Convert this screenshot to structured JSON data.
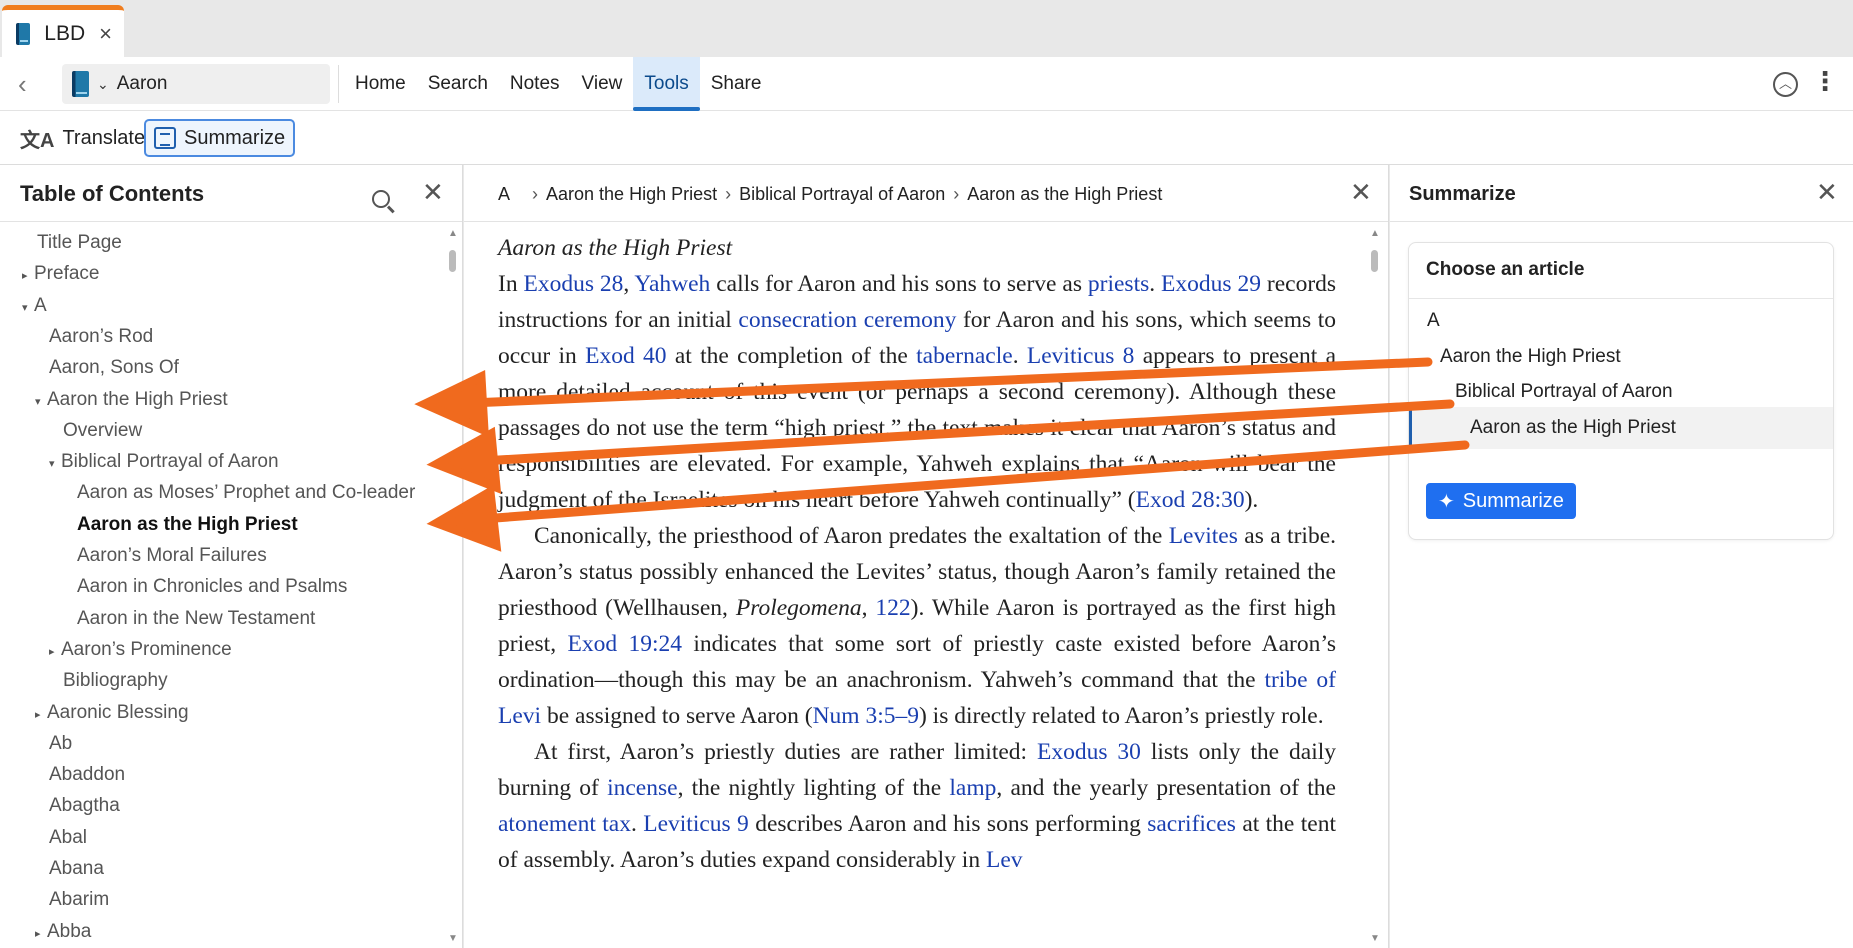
{
  "tab": {
    "title": "LBD",
    "close": "×"
  },
  "nav": {
    "back": "‹",
    "resource": "Aaron",
    "menu": [
      "Home",
      "Search",
      "Notes",
      "View",
      "Tools",
      "Share"
    ],
    "active_menu": "Tools"
  },
  "tools": {
    "translate": "Translate",
    "summarize": "Summarize"
  },
  "toc": {
    "title": "Table of Contents",
    "items": [
      {
        "label": "Title Page",
        "indent": 0,
        "toggle": ""
      },
      {
        "label": "Preface",
        "indent": 0,
        "toggle": "▸"
      },
      {
        "label": "A",
        "indent": 0,
        "toggle": "▾"
      },
      {
        "label": "Aaron’s Rod",
        "indent": 1,
        "toggle": ""
      },
      {
        "label": "Aaron, Sons Of",
        "indent": 1,
        "toggle": ""
      },
      {
        "label": "Aaron the High Priest",
        "indent": 1,
        "toggle": "▾"
      },
      {
        "label": "Overview",
        "indent": 2,
        "toggle": ""
      },
      {
        "label": "Biblical Portrayal of Aaron",
        "indent": 2,
        "toggle": "▾"
      },
      {
        "label": "Aaron as Moses’ Prophet and Co-leader",
        "indent": 3,
        "toggle": ""
      },
      {
        "label": "Aaron as the High Priest",
        "indent": 3,
        "toggle": "",
        "bold": true
      },
      {
        "label": "Aaron’s Moral Failures",
        "indent": 3,
        "toggle": ""
      },
      {
        "label": "Aaron in Chronicles and Psalms",
        "indent": 3,
        "toggle": ""
      },
      {
        "label": "Aaron in the New Testament",
        "indent": 3,
        "toggle": ""
      },
      {
        "label": "Aaron’s Prominence",
        "indent": 2,
        "toggle": "▸"
      },
      {
        "label": "Bibliography",
        "indent": 2,
        "toggle": ""
      },
      {
        "label": "Aaronic Blessing",
        "indent": 1,
        "toggle": "▸"
      },
      {
        "label": "Ab",
        "indent": 1,
        "toggle": ""
      },
      {
        "label": "Abaddon",
        "indent": 1,
        "toggle": ""
      },
      {
        "label": "Abagtha",
        "indent": 1,
        "toggle": ""
      },
      {
        "label": "Abal",
        "indent": 1,
        "toggle": ""
      },
      {
        "label": "Abana",
        "indent": 1,
        "toggle": ""
      },
      {
        "label": "Abarim",
        "indent": 1,
        "toggle": ""
      },
      {
        "label": "Abba",
        "indent": 1,
        "toggle": "▸"
      }
    ]
  },
  "article": {
    "breadcrumb": [
      "A",
      "Aaron the High Priest",
      "Biblical Portrayal of Aaron",
      "Aaron as the High Priest"
    ],
    "heading": "Aaron as the High Priest",
    "paragraphs": [
      [
        {
          "t": "In "
        },
        {
          "t": "Exodus 28",
          "l": true
        },
        {
          "t": ", "
        },
        {
          "t": "Yahweh",
          "l": true
        },
        {
          "t": " calls for Aaron and his sons to serve as "
        },
        {
          "t": "priests",
          "l": true
        },
        {
          "t": ". "
        },
        {
          "t": "Exodus 29",
          "l": true
        },
        {
          "t": " records instructions for an initial "
        },
        {
          "t": "consecration ceremony",
          "l": true
        },
        {
          "t": " for Aaron and his sons, which seems to occur in "
        },
        {
          "t": "Exod 40",
          "l": true
        },
        {
          "t": " at the completion of the "
        },
        {
          "t": "tabernacle",
          "l": true
        },
        {
          "t": ". "
        },
        {
          "t": "Leviticus 8",
          "l": true
        },
        {
          "t": " appears to present a more detailed account of this event (or perhaps a second ceremony). Although these passages do not use the term “high priest,” the text makes it clear that Aaron’s status and responsibilities are elevated. For example, Yahweh explains that “Aaron will bear the judgment of the Israelites on his heart before Yahweh continually” ("
        },
        {
          "t": "Exod 28:30",
          "l": true
        },
        {
          "t": ")."
        }
      ],
      [
        {
          "t": "Canonically, the priesthood of Aaron predates the exaltation of the "
        },
        {
          "t": "Levites",
          "l": true
        },
        {
          "t": " as a tribe. Aaron’s status possibly enhanced the Levites’ status, though Aaron’s family retained the priesthood (Wellhausen, "
        },
        {
          "t": "Prolegomena",
          "i": true
        },
        {
          "t": ", "
        },
        {
          "t": "122",
          "l": true
        },
        {
          "t": "). While Aaron is portrayed as the first high priest, "
        },
        {
          "t": "Exod 19:24",
          "l": true
        },
        {
          "t": " indicates that some sort of priestly caste existed before Aaron’s ordination—though this may be an anachronism. Yahweh’s command that the "
        },
        {
          "t": "tribe of Levi",
          "l": true
        },
        {
          "t": " be assigned to serve Aaron ("
        },
        {
          "t": "Num 3:5–9",
          "l": true
        },
        {
          "t": ") is directly related to Aaron’s priestly role."
        }
      ],
      [
        {
          "t": "At first, Aaron’s priestly duties are rather limited: "
        },
        {
          "t": "Exodus 30",
          "l": true
        },
        {
          "t": " lists only the daily burning of "
        },
        {
          "t": "incense",
          "l": true
        },
        {
          "t": ", the nightly lighting of the "
        },
        {
          "t": "lamp",
          "l": true
        },
        {
          "t": ", and the yearly presen­tation of the "
        },
        {
          "t": "atonement tax",
          "l": true
        },
        {
          "t": ". "
        },
        {
          "t": "Leviticus 9",
          "l": true
        },
        {
          "t": " describes Aaron and his sons perform­ing "
        },
        {
          "t": "sacrifices",
          "l": true
        },
        {
          "t": " at the tent of assembly. Aaron’s duties expand considerably in "
        },
        {
          "t": "Lev",
          "l": true
        }
      ]
    ]
  },
  "summarize_panel": {
    "title": "Summarize",
    "card_title": "Choose an article",
    "options": [
      {
        "label": "A",
        "indent": 0
      },
      {
        "label": "Aaron the High Priest",
        "indent": 1
      },
      {
        "label": "Biblical Portrayal of Aaron",
        "indent": 2
      },
      {
        "label": "Aaron as the High Priest",
        "indent": 3,
        "selected": true
      }
    ],
    "button": "Summarize"
  },
  "colors": {
    "accent": "#1f6fc2",
    "arrow": "#f06a1e",
    "link": "#1a3fb0",
    "tab_accent": "#f07d1e"
  }
}
